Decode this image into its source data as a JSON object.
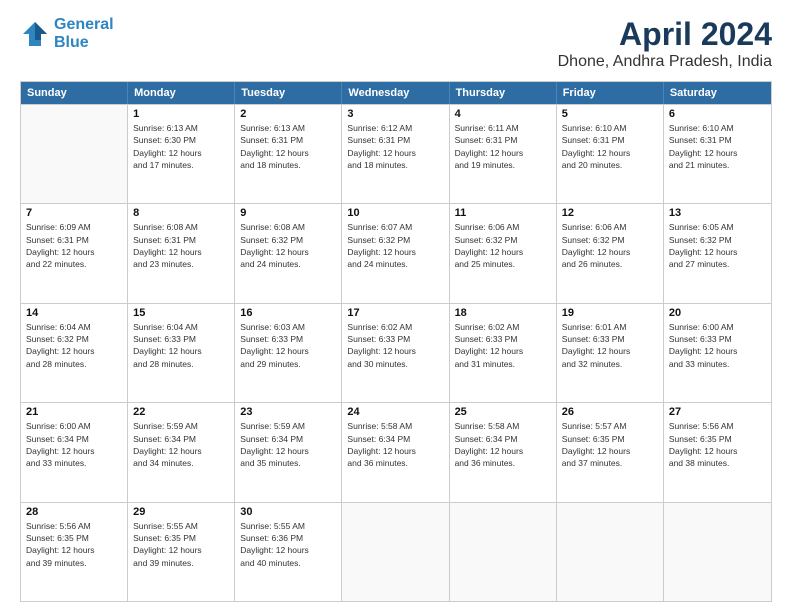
{
  "logo": {
    "line1": "General",
    "line2": "Blue"
  },
  "title": "April 2024",
  "subtitle": "Dhone, Andhra Pradesh, India",
  "header_days": [
    "Sunday",
    "Monday",
    "Tuesday",
    "Wednesday",
    "Thursday",
    "Friday",
    "Saturday"
  ],
  "weeks": [
    [
      {
        "day": "",
        "info": ""
      },
      {
        "day": "1",
        "info": "Sunrise: 6:13 AM\nSunset: 6:30 PM\nDaylight: 12 hours\nand 17 minutes."
      },
      {
        "day": "2",
        "info": "Sunrise: 6:13 AM\nSunset: 6:31 PM\nDaylight: 12 hours\nand 18 minutes."
      },
      {
        "day": "3",
        "info": "Sunrise: 6:12 AM\nSunset: 6:31 PM\nDaylight: 12 hours\nand 18 minutes."
      },
      {
        "day": "4",
        "info": "Sunrise: 6:11 AM\nSunset: 6:31 PM\nDaylight: 12 hours\nand 19 minutes."
      },
      {
        "day": "5",
        "info": "Sunrise: 6:10 AM\nSunset: 6:31 PM\nDaylight: 12 hours\nand 20 minutes."
      },
      {
        "day": "6",
        "info": "Sunrise: 6:10 AM\nSunset: 6:31 PM\nDaylight: 12 hours\nand 21 minutes."
      }
    ],
    [
      {
        "day": "7",
        "info": "Sunrise: 6:09 AM\nSunset: 6:31 PM\nDaylight: 12 hours\nand 22 minutes."
      },
      {
        "day": "8",
        "info": "Sunrise: 6:08 AM\nSunset: 6:31 PM\nDaylight: 12 hours\nand 23 minutes."
      },
      {
        "day": "9",
        "info": "Sunrise: 6:08 AM\nSunset: 6:32 PM\nDaylight: 12 hours\nand 24 minutes."
      },
      {
        "day": "10",
        "info": "Sunrise: 6:07 AM\nSunset: 6:32 PM\nDaylight: 12 hours\nand 24 minutes."
      },
      {
        "day": "11",
        "info": "Sunrise: 6:06 AM\nSunset: 6:32 PM\nDaylight: 12 hours\nand 25 minutes."
      },
      {
        "day": "12",
        "info": "Sunrise: 6:06 AM\nSunset: 6:32 PM\nDaylight: 12 hours\nand 26 minutes."
      },
      {
        "day": "13",
        "info": "Sunrise: 6:05 AM\nSunset: 6:32 PM\nDaylight: 12 hours\nand 27 minutes."
      }
    ],
    [
      {
        "day": "14",
        "info": "Sunrise: 6:04 AM\nSunset: 6:32 PM\nDaylight: 12 hours\nand 28 minutes."
      },
      {
        "day": "15",
        "info": "Sunrise: 6:04 AM\nSunset: 6:33 PM\nDaylight: 12 hours\nand 28 minutes."
      },
      {
        "day": "16",
        "info": "Sunrise: 6:03 AM\nSunset: 6:33 PM\nDaylight: 12 hours\nand 29 minutes."
      },
      {
        "day": "17",
        "info": "Sunrise: 6:02 AM\nSunset: 6:33 PM\nDaylight: 12 hours\nand 30 minutes."
      },
      {
        "day": "18",
        "info": "Sunrise: 6:02 AM\nSunset: 6:33 PM\nDaylight: 12 hours\nand 31 minutes."
      },
      {
        "day": "19",
        "info": "Sunrise: 6:01 AM\nSunset: 6:33 PM\nDaylight: 12 hours\nand 32 minutes."
      },
      {
        "day": "20",
        "info": "Sunrise: 6:00 AM\nSunset: 6:33 PM\nDaylight: 12 hours\nand 33 minutes."
      }
    ],
    [
      {
        "day": "21",
        "info": "Sunrise: 6:00 AM\nSunset: 6:34 PM\nDaylight: 12 hours\nand 33 minutes."
      },
      {
        "day": "22",
        "info": "Sunrise: 5:59 AM\nSunset: 6:34 PM\nDaylight: 12 hours\nand 34 minutes."
      },
      {
        "day": "23",
        "info": "Sunrise: 5:59 AM\nSunset: 6:34 PM\nDaylight: 12 hours\nand 35 minutes."
      },
      {
        "day": "24",
        "info": "Sunrise: 5:58 AM\nSunset: 6:34 PM\nDaylight: 12 hours\nand 36 minutes."
      },
      {
        "day": "25",
        "info": "Sunrise: 5:58 AM\nSunset: 6:34 PM\nDaylight: 12 hours\nand 36 minutes."
      },
      {
        "day": "26",
        "info": "Sunrise: 5:57 AM\nSunset: 6:35 PM\nDaylight: 12 hours\nand 37 minutes."
      },
      {
        "day": "27",
        "info": "Sunrise: 5:56 AM\nSunset: 6:35 PM\nDaylight: 12 hours\nand 38 minutes."
      }
    ],
    [
      {
        "day": "28",
        "info": "Sunrise: 5:56 AM\nSunset: 6:35 PM\nDaylight: 12 hours\nand 39 minutes."
      },
      {
        "day": "29",
        "info": "Sunrise: 5:55 AM\nSunset: 6:35 PM\nDaylight: 12 hours\nand 39 minutes."
      },
      {
        "day": "30",
        "info": "Sunrise: 5:55 AM\nSunset: 6:36 PM\nDaylight: 12 hours\nand 40 minutes."
      },
      {
        "day": "",
        "info": ""
      },
      {
        "day": "",
        "info": ""
      },
      {
        "day": "",
        "info": ""
      },
      {
        "day": "",
        "info": ""
      }
    ]
  ]
}
